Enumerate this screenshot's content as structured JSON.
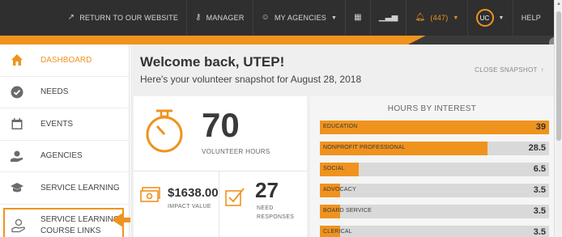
{
  "topnav": {
    "items": [
      {
        "label": "RETURN TO OUR WEBSITE",
        "icon": "external-link-icon"
      },
      {
        "label": "MANAGER",
        "icon": "key-icon"
      },
      {
        "label": "MY AGENCIES",
        "icon": "users-icon"
      },
      {
        "label": "",
        "icon": "calendar-icon"
      },
      {
        "label": "",
        "icon": "chart-icon"
      },
      {
        "label": "(447)",
        "icon": "bell-icon"
      },
      {
        "label": "UC",
        "icon": "avatar"
      },
      {
        "label": "HELP",
        "icon": ""
      }
    ]
  },
  "sidebar": {
    "items": [
      {
        "label": "DASHBOARD",
        "icon": "home-icon"
      },
      {
        "label": "NEEDS",
        "icon": "check-circle-icon"
      },
      {
        "label": "EVENTS",
        "icon": "calendar-icon"
      },
      {
        "label": "AGENCIES",
        "icon": "hand-heart-icon"
      },
      {
        "label": "SERVICE LEARNING",
        "icon": "graduation-cap-icon"
      },
      {
        "label": "SERVICE LEARNING COURSE LINKS",
        "icon": "hand-link-icon"
      }
    ]
  },
  "main": {
    "welcome": "Welcome back, UTEP!",
    "snapshot": "Here's your volunteer snapshot for August 28, 2018",
    "close_snapshot": "CLOSE SNAPSHOT",
    "volunteer_hours": {
      "value": "70",
      "label": "VOLUNTEER HOURS"
    },
    "impact": {
      "value": "$1638.00",
      "label": "IMPACT VALUE"
    },
    "needs": {
      "value": "27",
      "label": "NEED RESPONSES"
    },
    "hours_by_interest": {
      "title": "HOURS BY INTEREST",
      "rows": [
        {
          "label": "EDUCATION",
          "value": "39",
          "fraction": 1.0
        },
        {
          "label": "NONPROFIT PROFESSIONAL",
          "value": "28.5",
          "fraction": 0.73
        },
        {
          "label": "SOCIAL",
          "value": "6.5",
          "fraction": 0.17
        },
        {
          "label": "ADVOCACY",
          "value": "3.5",
          "fraction": 0.09
        },
        {
          "label": "BOARD SERVICE",
          "value": "3.5",
          "fraction": 0.09
        },
        {
          "label": "CLERICAL",
          "value": "3.5",
          "fraction": 0.09
        }
      ]
    }
  },
  "colors": {
    "accent": "#f0931e",
    "topbar": "#2f2f2f"
  }
}
